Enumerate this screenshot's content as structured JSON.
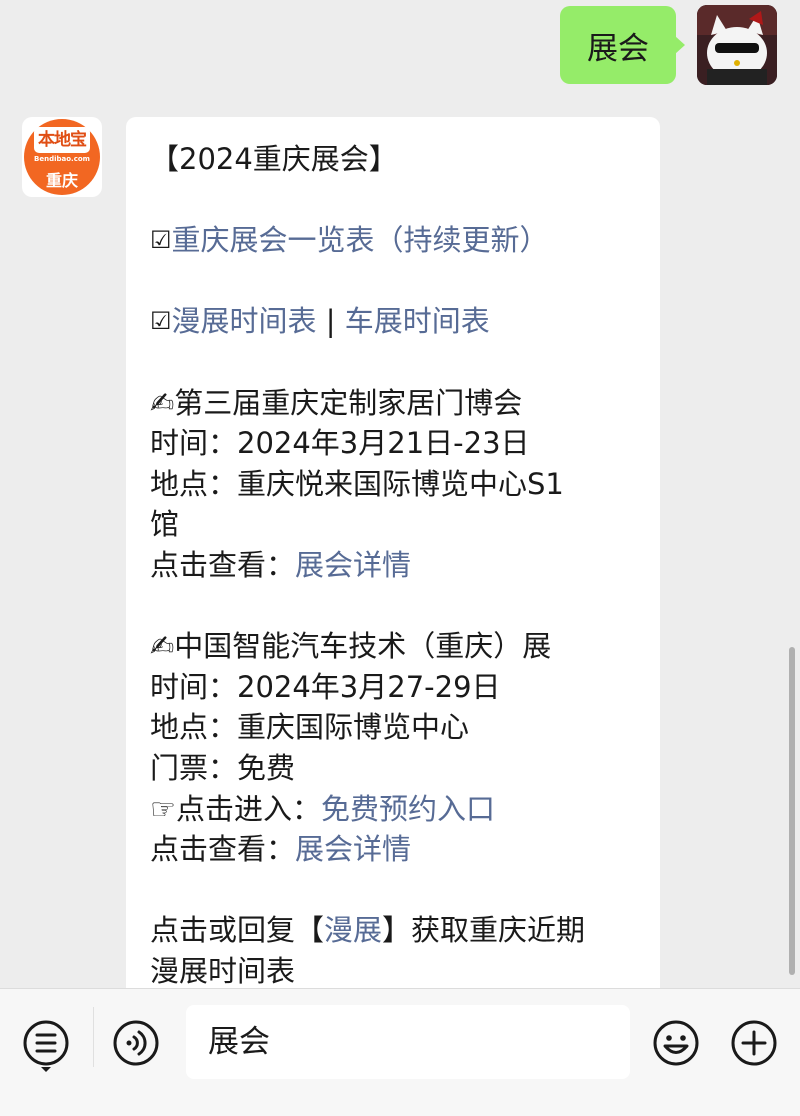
{
  "outgoing": {
    "text": "展会"
  },
  "bot": {
    "logo_name": "本地宝",
    "logo_url": "Bendibao.com",
    "logo_city": "重庆"
  },
  "message": {
    "title": "【2024重庆展会】",
    "check_symbol": "☑",
    "link_list": "重庆展会一览表（持续更新）",
    "link_comic": "漫展时间表",
    "separator": " | ",
    "link_car": "车展时间表",
    "event1": {
      "name": "✍第三届重庆定制家居门博会",
      "time": "时间：2024年3月21日-23日",
      "place_line1": "地点：重庆悦来国际博览中心S1",
      "place_line2": "馆",
      "detail_prefix": "点击查看：",
      "detail_link": "展会详情"
    },
    "event2": {
      "name": "✍中国智能汽车技术（重庆）展",
      "time": "时间：2024年3月27-29日",
      "place": "地点：重庆国际博览中心",
      "ticket": "门票：免费",
      "enter_prefix": "☞点击进入：",
      "enter_link": "免费预约入口",
      "detail_prefix": "点击查看：",
      "detail_link": "展会详情"
    },
    "reply_prefix": "点击或回复【",
    "reply_keyword": "漫展",
    "reply_suffix": "】获取重庆近期",
    "reply_line2": "漫展时间表"
  },
  "input": {
    "value": "展会"
  },
  "icons": {
    "menu": "menu-list-icon",
    "voice": "voice-icon",
    "emoji": "emoji-icon",
    "add": "add-icon"
  },
  "colors": {
    "outgoing_bubble": "#95ec69",
    "link": "#576b95",
    "background": "#ededed",
    "logo_orange": "#f26722"
  }
}
